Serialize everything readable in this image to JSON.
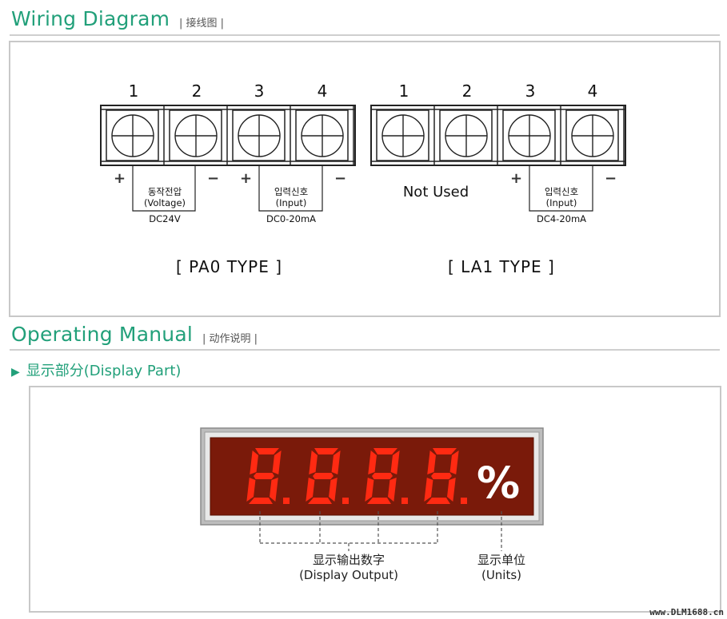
{
  "wiring": {
    "title": "Wiring Diagram",
    "subtitle": "| 接线图 |",
    "pa0": {
      "terminals": [
        "1",
        "2",
        "3",
        "4"
      ],
      "plus1": "+",
      "minus1": "−",
      "label1_k": "동작전압",
      "label1_e": "(Voltage)",
      "label1_v": "DC24V",
      "plus2": "+",
      "minus2": "−",
      "label2_k": "입력신호",
      "label2_e": "(Input)",
      "label2_v": "DC0-20mA",
      "type_label": "[ PA0  TYPE ]"
    },
    "la1": {
      "terminals": [
        "1",
        "2",
        "3",
        "4"
      ],
      "not_used": "Not Used",
      "plus": "+",
      "minus": "−",
      "label_k": "입력신호",
      "label_e": "(Input)",
      "label_v": "DC4-20mA",
      "type_label": "[ LA1  TYPE ]"
    }
  },
  "manual": {
    "title": "Operating Manual",
    "subtitle": "| 动作说明 |",
    "display_part": "显示部分(Display  Part)",
    "display": {
      "digits": "8.8.8.8.",
      "unit": "%",
      "output_label_cn": "显示输出数字",
      "output_label_en": "(Display  Output)",
      "unit_label_cn": "显示单位",
      "unit_label_en": "(Units)",
      "led_color": "#ff2a12",
      "bg_color": "#7a1a0a"
    }
  },
  "watermark": "www.DLM1688.cn",
  "colors": {
    "accent": "#22a07a"
  }
}
